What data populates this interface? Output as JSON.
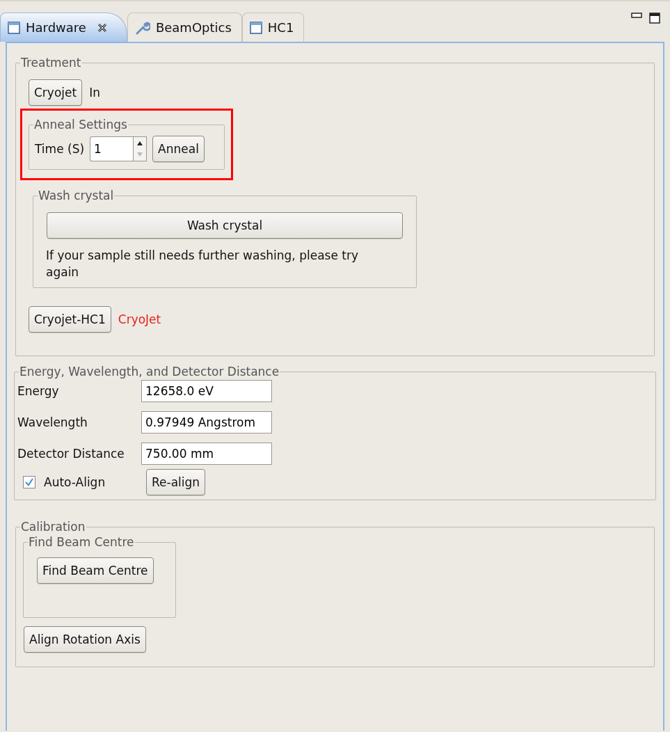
{
  "tabs": [
    {
      "label": "Hardware",
      "kind": "view",
      "selected": true,
      "closable": true
    },
    {
      "label": "BeamOptics",
      "kind": "tool",
      "selected": false,
      "closable": false
    },
    {
      "label": "HC1",
      "kind": "view",
      "selected": false,
      "closable": false
    }
  ],
  "treatment": {
    "title": "Treatment",
    "cryojet_button": "Cryojet",
    "cryojet_state": "In",
    "anneal": {
      "title": "Anneal Settings",
      "highlighted": true,
      "time_label": "Time (S)",
      "time_value": "1",
      "button": "Anneal"
    },
    "wash": {
      "title": "Wash crystal",
      "button": "Wash crystal",
      "message": "If your sample still needs further washing, please try again"
    },
    "hc1_button": "Cryojet-HC1",
    "hc1_status": "CryoJet"
  },
  "energy": {
    "title": "Energy, Wavelength, and Detector Distance",
    "fields": [
      {
        "label": "Energy",
        "value": "12658.0 eV"
      },
      {
        "label": "Wavelength",
        "value": "0.97949 Angstrom"
      },
      {
        "label": "Detector Distance",
        "value": "750.00 mm"
      }
    ],
    "auto_align": {
      "label": "Auto-Align",
      "checked": true
    },
    "realign_button": "Re-align"
  },
  "calibration": {
    "title": "Calibration",
    "find_beam": {
      "title": "Find Beam Centre",
      "button": "Find Beam Centre"
    },
    "align_button": "Align Rotation Axis"
  }
}
